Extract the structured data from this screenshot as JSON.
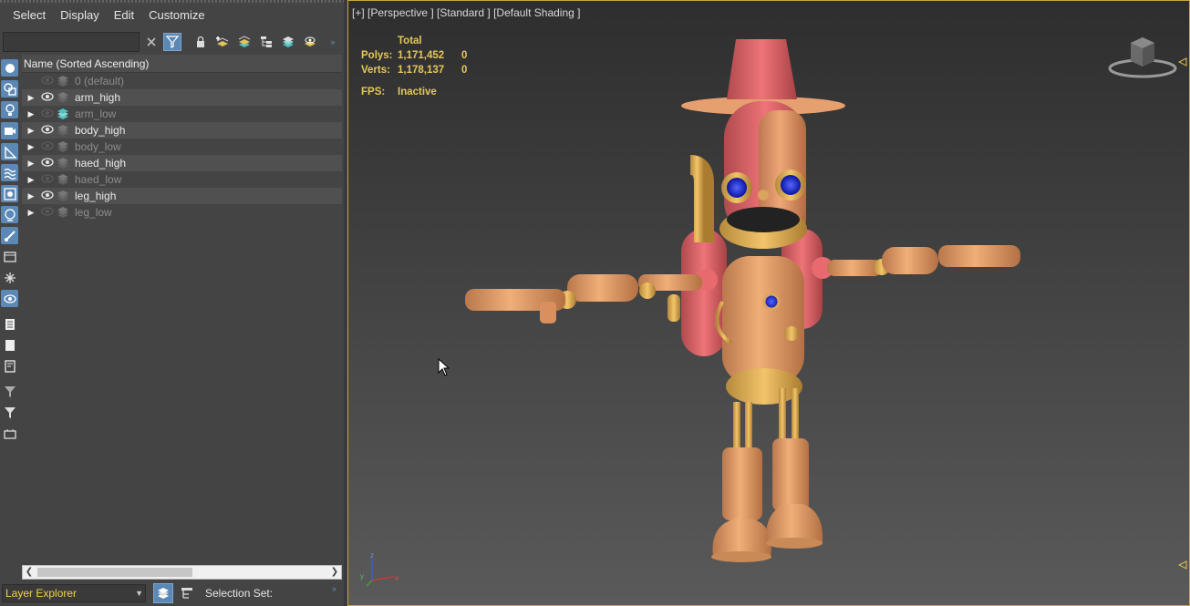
{
  "menu": [
    "Select",
    "Display",
    "Edit",
    "Customize"
  ],
  "search": {
    "value": "",
    "placeholder": ""
  },
  "tree": {
    "header": "Name (Sorted Ascending)",
    "rows": [
      {
        "label": "0 (default)",
        "state": "frozen",
        "expander": false,
        "eye": "hidden",
        "icon": "layer-gray"
      },
      {
        "label": "arm_high",
        "state": "normal",
        "expander": true,
        "eye": "visible",
        "icon": "layer-gray"
      },
      {
        "label": "arm_low",
        "state": "frozen",
        "expander": true,
        "eye": "hidden",
        "icon": "layer-teal"
      },
      {
        "label": "body_high",
        "state": "normal",
        "expander": true,
        "eye": "visible",
        "icon": "layer-gray"
      },
      {
        "label": "body_low",
        "state": "frozen",
        "expander": true,
        "eye": "hidden",
        "icon": "layer-gray"
      },
      {
        "label": "haed_high",
        "state": "normal",
        "expander": true,
        "eye": "visible",
        "icon": "layer-gray"
      },
      {
        "label": "haed_low",
        "state": "frozen",
        "expander": true,
        "eye": "hidden",
        "icon": "layer-gray"
      },
      {
        "label": "leg_high",
        "state": "normal",
        "expander": true,
        "eye": "visible",
        "icon": "layer-gray"
      },
      {
        "label": "leg_low",
        "state": "frozen",
        "expander": true,
        "eye": "hidden",
        "icon": "layer-gray"
      }
    ]
  },
  "bottom": {
    "explorer": "Layer Explorer",
    "selection_set": "Selection Set:"
  },
  "viewport": {
    "label": "[+] [Perspective ] [Standard ] [Default Shading ]",
    "stats": {
      "total": "Total",
      "polys_label": "Polys:",
      "polys": "1,171,452",
      "polys_sel": "0",
      "verts_label": "Verts:",
      "verts": "1,178,137",
      "verts_sel": "0",
      "fps_label": "FPS:",
      "fps": "Inactive"
    },
    "axis": {
      "x": "x",
      "y": "y",
      "z": "z"
    }
  },
  "colors": {
    "accent": "#5b88b4",
    "stats": "#e4c75a",
    "border": "#c9a640",
    "robot_body": "#d99a6a",
    "robot_red": "#e0676a",
    "eye_blue": "#1c2bd6"
  }
}
